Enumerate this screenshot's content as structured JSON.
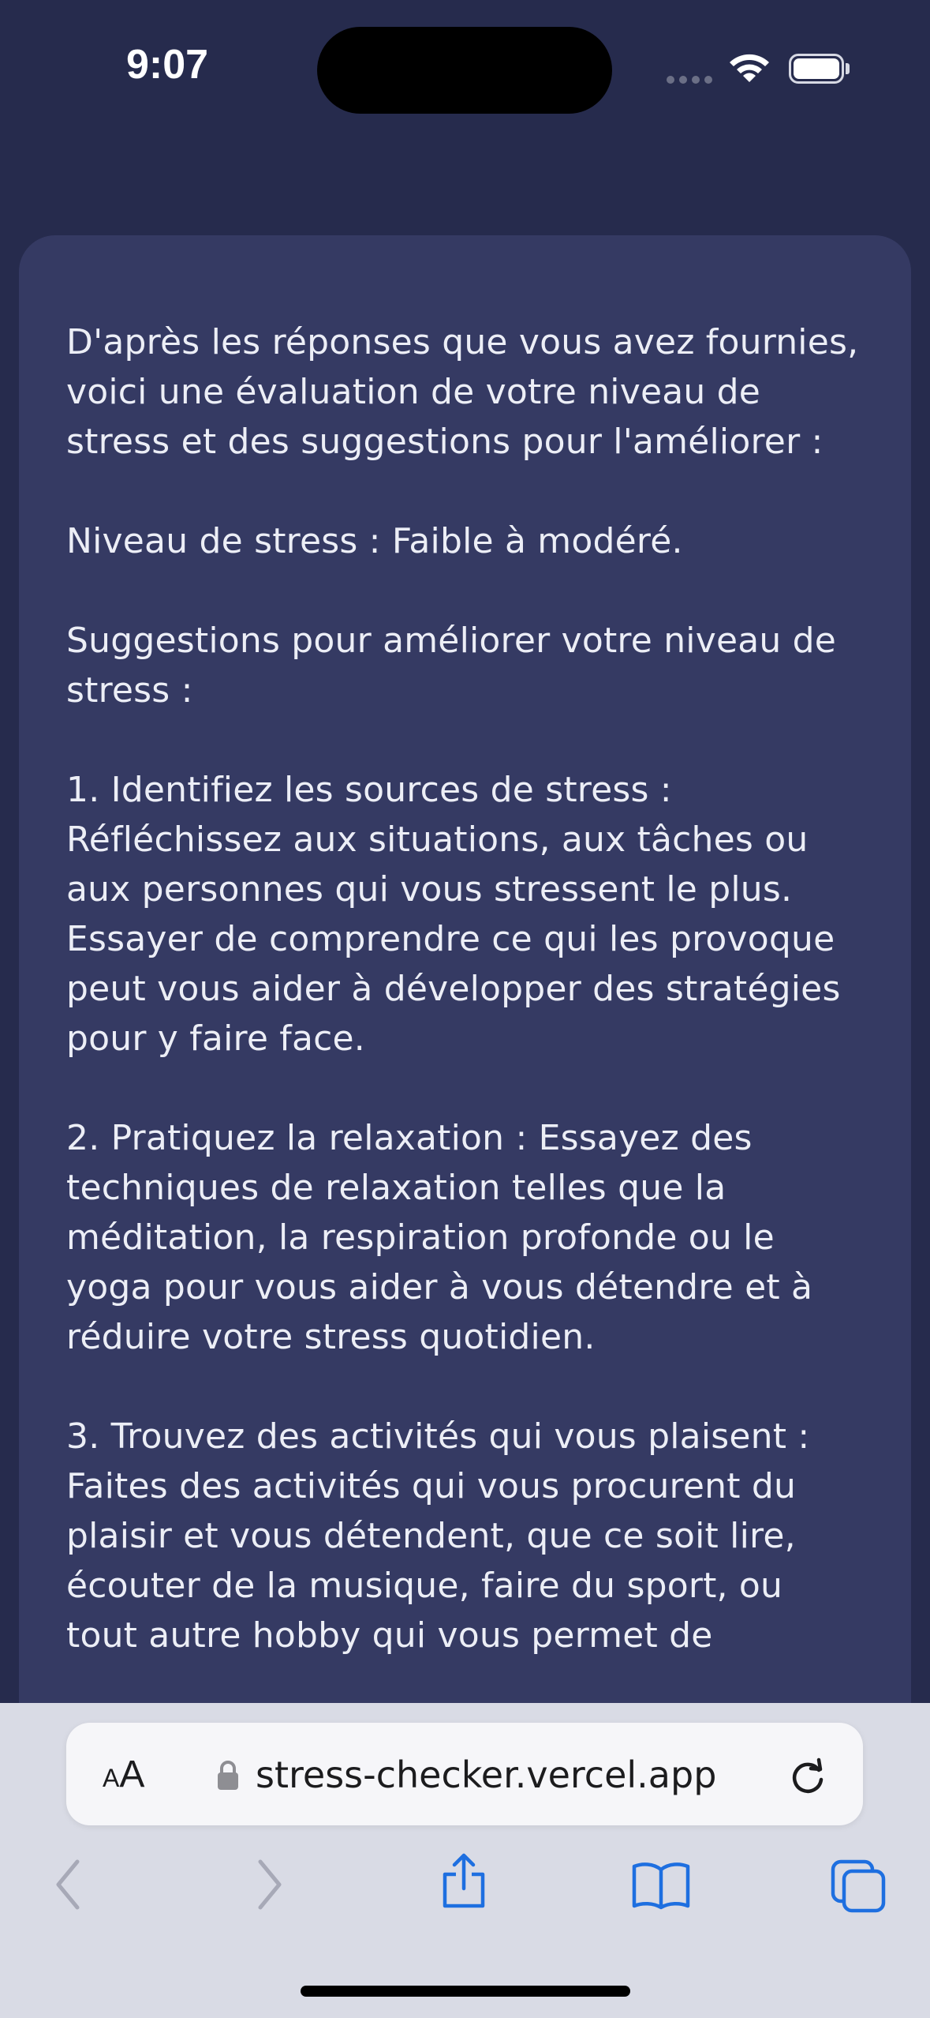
{
  "status_bar": {
    "time": "9:07"
  },
  "message": {
    "paragraphs": [
      "D'après les réponses que vous avez fournies, voici une évaluation de votre niveau de stress et des suggestions pour l'améliorer :",
      "Niveau de stress : Faible à modéré.",
      "Suggestions pour améliorer votre niveau de stress :",
      "1. Identifiez les sources de stress : Réfléchissez aux situations, aux tâches ou aux personnes qui vous stressent le plus. Essayer de comprendre ce qui les provoque peut vous aider à développer des stratégies pour y faire face.",
      "2. Pratiquez la relaxation : Essayez des techniques de relaxation telles que la méditation, la respiration profonde ou le yoga pour vous aider à vous détendre et à réduire votre stress quotidien.",
      "3. Trouvez des activités qui vous plaisent : Faites des activités qui vous procurent du plaisir et vous détendent, que ce soit lire, écouter de la musique, faire du sport, ou tout autre hobby qui vous permet de"
    ]
  },
  "browser": {
    "text_size_label": "AA",
    "url": "stress-checker.vercel.app",
    "icons": {
      "text_size": "text-size-icon",
      "lock": "lock-icon",
      "reload": "reload-icon",
      "back": "chevron-left-icon",
      "forward": "chevron-right-icon",
      "share": "share-icon",
      "bookmarks": "book-icon",
      "tabs": "tabs-icon"
    }
  },
  "colors": {
    "background": "#262b4d",
    "card": "#353a63",
    "text": "#eceef6",
    "toolbar": "#d9dbe5",
    "accent": "#1e6fe0"
  }
}
